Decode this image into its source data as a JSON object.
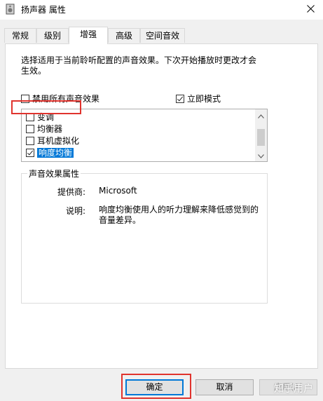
{
  "window": {
    "title": "扬声器 属性",
    "icons": {
      "app": "speaker-icon",
      "close": "close-icon"
    }
  },
  "tabs": [
    {
      "label": "常规",
      "active": false
    },
    {
      "label": "级别",
      "active": false
    },
    {
      "label": "增强",
      "active": true
    },
    {
      "label": "高级",
      "active": false
    },
    {
      "label": "空间音效",
      "active": false
    }
  ],
  "enhancements": {
    "description": "选择适用于当前聆听配置的声音效果。下次开始播放时更改才会生效。",
    "disable_all": {
      "label": "禁用所有声音效果",
      "checked": false
    },
    "immediate_mode": {
      "label": "立即模式",
      "checked": true
    },
    "items": [
      {
        "label": "变调",
        "checked": false
      },
      {
        "label": "均衡器",
        "checked": false
      },
      {
        "label": "耳机虚拟化",
        "checked": false
      },
      {
        "label": "响度均衡",
        "checked": true,
        "selected": true
      }
    ],
    "properties": {
      "group_title": "声音效果属性",
      "provider_key": "提供商:",
      "provider_value": "Microsoft",
      "desc_key": "说明:",
      "desc_value": "响度均衡使用人的听力理解来降低感觉到的音量差异。"
    }
  },
  "buttons": {
    "ok": "确定",
    "cancel": "取消",
    "apply": "应用(A)"
  },
  "watermark": "知乎用户",
  "colors": {
    "accent": "#0078d7",
    "highlight_box": "#e0332d"
  }
}
